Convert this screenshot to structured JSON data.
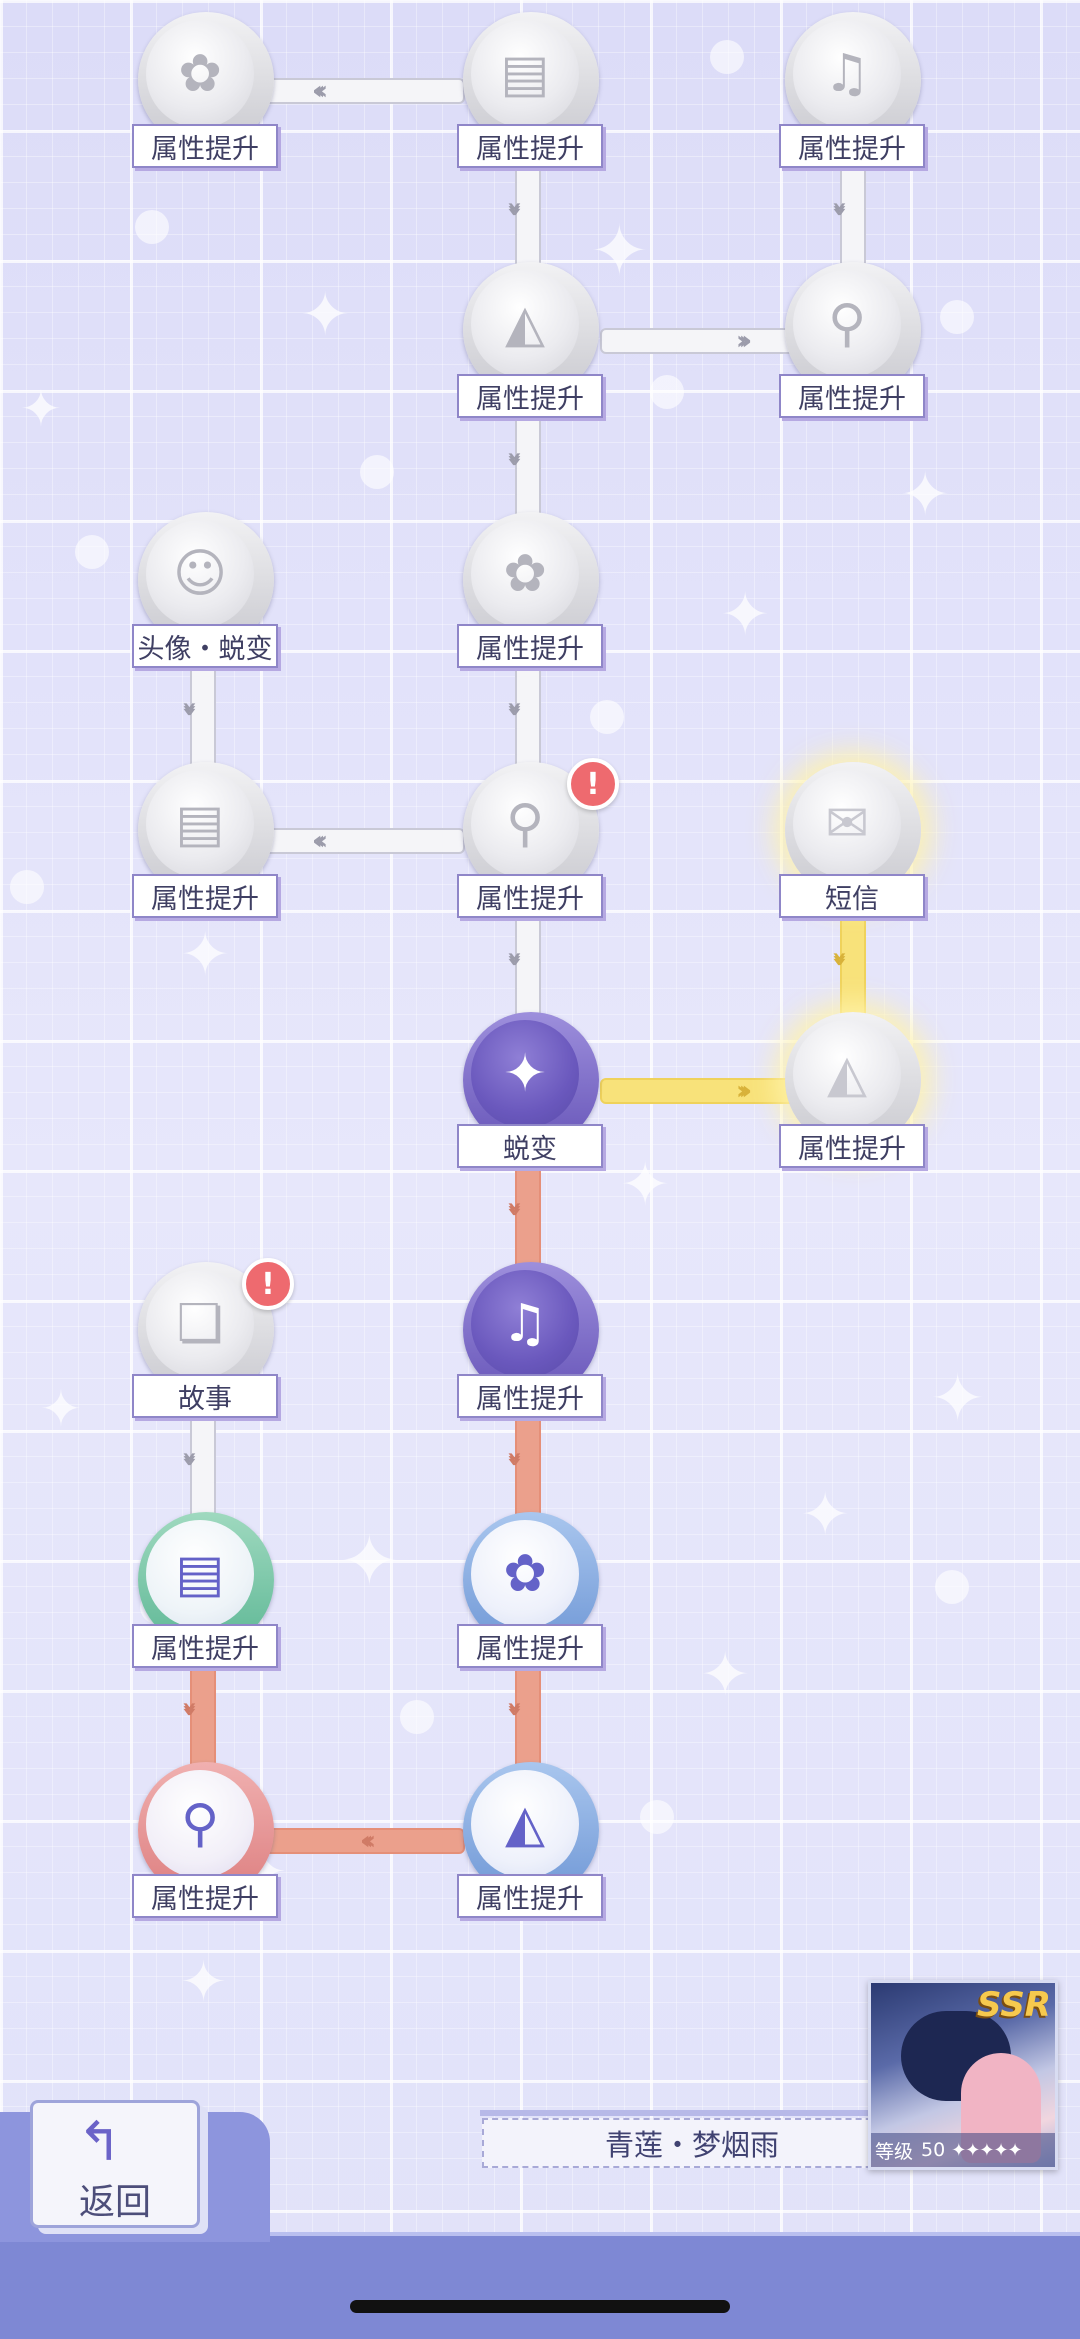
{
  "nodes": {
    "n_top_left": {
      "label": "属性提升",
      "icon": "telescope-rose-icon",
      "state": "locked"
    },
    "n_top_mid": {
      "label": "属性提升",
      "icon": "book-icon",
      "state": "locked"
    },
    "n_top_right": {
      "label": "属性提升",
      "icon": "music-note-icon",
      "state": "locked"
    },
    "n_row2_mid": {
      "label": "属性提升",
      "icon": "fan-icon",
      "state": "locked"
    },
    "n_row2_right": {
      "label": "属性提升",
      "icon": "constellation-icon",
      "state": "locked"
    },
    "n_row3_left": {
      "label": "头像・蜕变",
      "icon": "avatar-icon",
      "state": "locked"
    },
    "n_row3_mid": {
      "label": "属性提升",
      "icon": "telescope-rose-icon",
      "state": "locked"
    },
    "n_row4_left": {
      "label": "属性提升",
      "icon": "book-icon",
      "state": "locked"
    },
    "n_row4_mid": {
      "label": "属性提升",
      "icon": "constellation-icon",
      "state": "locked",
      "alert": "!"
    },
    "n_row4_right": {
      "label": "短信",
      "icon": "message-card-icon",
      "state": "available"
    },
    "n_row5_mid": {
      "label": "蜕变",
      "icon": "star-card-icon",
      "state": "unlocked"
    },
    "n_row5_right": {
      "label": "属性提升",
      "icon": "fan-icon",
      "state": "available"
    },
    "n_row6_left": {
      "label": "故事",
      "icon": "story-cards-icon",
      "state": "locked",
      "alert": "!"
    },
    "n_row6_mid": {
      "label": "属性提升",
      "icon": "music-note-icon",
      "state": "unlocked"
    },
    "n_row7_left": {
      "label": "属性提升",
      "icon": "book-icon",
      "state": "unlocked"
    },
    "n_row7_mid": {
      "label": "属性提升",
      "icon": "telescope-rose-icon",
      "state": "unlocked"
    },
    "n_row8_left": {
      "label": "属性提升",
      "icon": "constellation-icon",
      "state": "unlocked"
    },
    "n_row8_mid": {
      "label": "属性提升",
      "icon": "fan-icon",
      "state": "unlocked"
    }
  },
  "back_button": {
    "label": "返回",
    "icon": "return-arrow-icon"
  },
  "character": {
    "name": "青莲・梦烟雨"
  },
  "card": {
    "rarity": "SSR",
    "level_label": "等级",
    "level": "50",
    "stars": "✦✦✦✦✦"
  },
  "colors": {
    "locked": "#c9c9cf",
    "unlocked": "#6856b9",
    "gold_path": "#f8e27a",
    "coral_path": "#eba08c",
    "alert": "#ee6a6f",
    "bar": "#7e88d4"
  }
}
